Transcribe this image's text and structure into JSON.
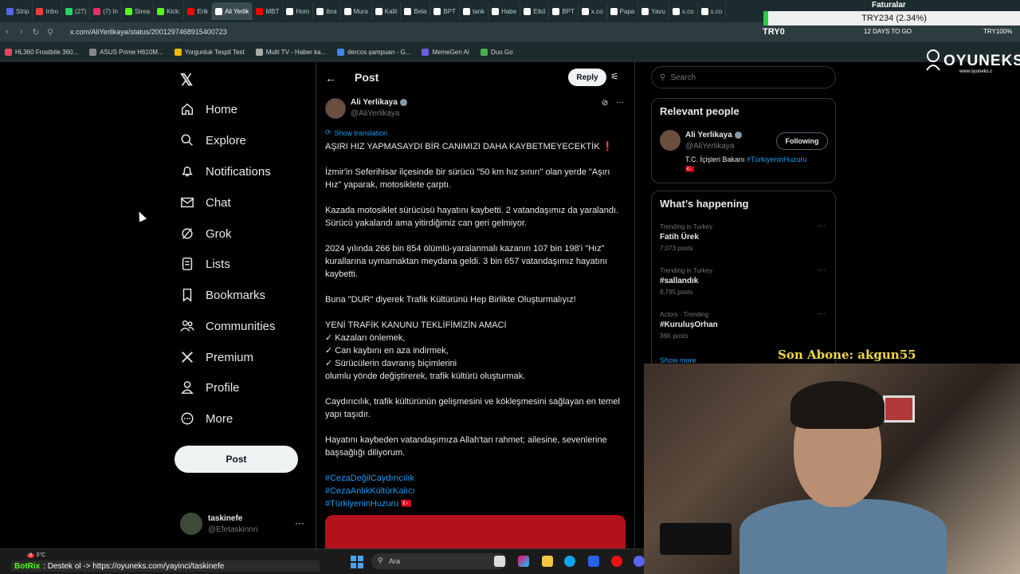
{
  "browser": {
    "tabs": [
      {
        "label": "Strip",
        "color": "#5865f2"
      },
      {
        "label": "Inbo",
        "color": "#ea4335"
      },
      {
        "label": "(27)",
        "color": "#25d366"
      },
      {
        "label": "(7) In",
        "color": "#e1306c"
      },
      {
        "label": "Strea",
        "color": "#53fc18"
      },
      {
        "label": "Kick:",
        "color": "#53fc18"
      },
      {
        "label": "Erik",
        "color": "#ff0000"
      },
      {
        "label": "Ali Yerlik",
        "color": "#ffffff"
      },
      {
        "label": "MBT",
        "color": "#ff0000"
      },
      {
        "label": "Hom",
        "color": "#ffffff"
      },
      {
        "label": "ibra",
        "color": "#ffffff"
      },
      {
        "label": "Mura",
        "color": "#ffffff"
      },
      {
        "label": "Kalit",
        "color": "#ffffff"
      },
      {
        "label": "Bela",
        "color": "#ffffff"
      },
      {
        "label": "BPT",
        "color": "#ffffff"
      },
      {
        "label": "tank",
        "color": "#ffffff"
      },
      {
        "label": "Habe",
        "color": "#ffffff"
      },
      {
        "label": "Etkil",
        "color": "#ffffff"
      },
      {
        "label": "BPT",
        "color": "#ffffff"
      },
      {
        "label": "x.co",
        "color": "#ffffff"
      },
      {
        "label": "Papa",
        "color": "#ffffff"
      },
      {
        "label": "Yavu",
        "color": "#ffffff"
      },
      {
        "label": "x.co",
        "color": "#ffffff"
      },
      {
        "label": "x.co",
        "color": "#ffffff"
      }
    ],
    "url": "x.com/AliYerlikaya/status/2001297468915400723",
    "bookmarks": [
      {
        "label": "HL360 Frostbite 360...",
        "color": "#e94560"
      },
      {
        "label": "ASUS Prime H610M...",
        "color": "#888888"
      },
      {
        "label": "Yorgunluk Tespit Test",
        "color": "#f4b400"
      },
      {
        "label": "Multi TV - Haber ka...",
        "color": "#aaaaaa"
      },
      {
        "label": "dercos şampuan - G...",
        "color": "#4285f4"
      },
      {
        "label": "MemeGen AI",
        "color": "#6c5ce7"
      },
      {
        "label": "Duo Go",
        "color": "#4caf50"
      }
    ]
  },
  "overlays": {
    "faturalar": "Faturalar",
    "try_box": "TRY234 (2.34%)",
    "try_label": "TRY0",
    "days_label": "12 DAYS TO GO",
    "try_right": "TRY100%",
    "logo_big": "OYUNEKS",
    "logo_small": "www.oyuneks.c",
    "son_abone": "Son Abone: akgun55",
    "botrix_name": "BotRix",
    "botrix_msg": ": Destek ol -> https://oyuneks.com/yayinci/taskinefe",
    "weather": "3°C"
  },
  "nav": {
    "items": [
      {
        "label": "Home",
        "icon": "home-icon"
      },
      {
        "label": "Explore",
        "icon": "search-icon"
      },
      {
        "label": "Notifications",
        "icon": "bell-icon"
      },
      {
        "label": "Chat",
        "icon": "mail-icon"
      },
      {
        "label": "Grok",
        "icon": "grok-icon"
      },
      {
        "label": "Lists",
        "icon": "list-icon"
      },
      {
        "label": "Bookmarks",
        "icon": "bookmark-icon"
      },
      {
        "label": "Communities",
        "icon": "people-icon"
      },
      {
        "label": "Premium",
        "icon": "x-logo-icon"
      },
      {
        "label": "Profile",
        "icon": "person-icon"
      },
      {
        "label": "More",
        "icon": "more-circle-icon"
      }
    ],
    "post_button": "Post",
    "account": {
      "name": "taskinefe",
      "handle": "@Efetaskinnn"
    }
  },
  "post": {
    "header_title": "Post",
    "reply_label": "Reply",
    "author_name": "Ali Yerlikaya",
    "author_handle": "@AliYerlikaya",
    "show_translation": "Show translation",
    "headline": "AŞIRI HIZ YAPMASAYDI BİR CANIMIZI DAHA KAYBETMEYECEKTİK",
    "paragraphs": [
      "İzmir'in Seferihisar ilçesinde bir sürücü \"50 km hız sınırı\" olan yerde \"Aşırı Hız\" yaparak, motosiklete çarptı.",
      "Kazada motosiklet sürücüsü hayatını kaybetti. 2 vatandaşımız da yaralandı. Sürücü yakalandı ama yitirdiğimiz can geri gelmiyor.",
      "2024 yılında 266 bin 854 ölümlü-yaralanmalı kazanın 107 bin 198'i \"Hız\" kurallarına uymamaktan meydana geldi. 3 bin 657 vatandaşımız hayatını kaybetti.",
      "Buna \"DUR\" diyerek Trafik Kültürünü Hep Birlikte Oluşturmalıyız!"
    ],
    "list_title": "YENİ TRAFİK KANUNU TEKLİFİMİZİN AMACI",
    "list_items": [
      "✓ Kazaları önlemek,",
      "✓ Can kaybını en aza indirmek,",
      "✓ Sürücülerin davranış biçimlerini"
    ],
    "list_tail": "olumlu yönde değiştirerek, trafik kültürü oluşturmak.",
    "para_after": "Caydırıcılık, trafik kültürünün gelişmesini ve kökleşmesini sağlayan en temel yapı taşıdır.",
    "para_final": "Hayatını kaybeden vatandaşımıza Allah'tan rahmet; ailesine, sevenlerine başsağlığı diliyorum.",
    "hashtags": [
      "#CezaDeğilCaydırıcılık",
      "#CezaAnlıkKültürKalıcı",
      "#TürkiyeninHuzuru"
    ]
  },
  "sidebar": {
    "search_placeholder": "Search",
    "relevant_title": "Relevant people",
    "person_name": "Ali Yerlikaya",
    "person_handle": "@AliYerlikaya",
    "follow_label": "Following",
    "bio_text": "T.C. İçişleri Bakanı ",
    "bio_tag": "#TürkiyeninHuzuru",
    "happening_title": "What’s happening",
    "trends": [
      {
        "context": "Trending in Turkey",
        "title": "Fatih Ürek",
        "count": "7,073 posts"
      },
      {
        "context": "Trending in Turkey",
        "title": "#sallandık",
        "count": "8,795 posts"
      },
      {
        "context": "Actors · Trending",
        "title": "#KuruluşOrhan",
        "count": "36K posts"
      }
    ],
    "show_more": "Show more"
  },
  "taskbar": {
    "search_placeholder": "Ara",
    "notif_count": "9"
  }
}
